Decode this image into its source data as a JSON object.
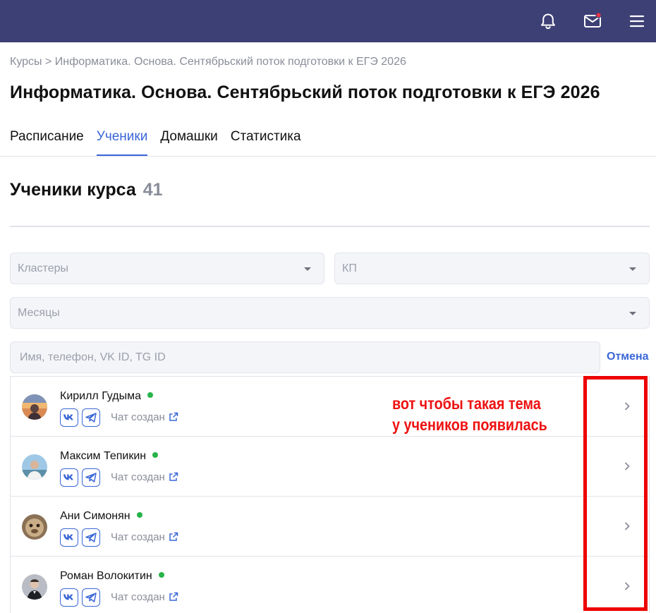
{
  "header": {
    "icons": [
      "bell-icon",
      "mail-icon",
      "menu-icon"
    ],
    "mail_badge_color": "#ee3344",
    "background": "#3d4075"
  },
  "breadcrumb": {
    "root": "Курсы",
    "separator": ">",
    "current": "Информатика. Основа. Сентябрьский поток подготовки к ЕГЭ 2026"
  },
  "page": {
    "title": "Информатика. Основа. Сентябрьский поток подготовки к ЕГЭ 2026"
  },
  "tabs": [
    {
      "label": "Расписание",
      "active": false
    },
    {
      "label": "Ученики",
      "active": true
    },
    {
      "label": "Домашки",
      "active": false
    },
    {
      "label": "Статистика",
      "active": false
    }
  ],
  "students_section": {
    "title": "Ученики курса",
    "count": "41"
  },
  "filters": {
    "clusters_placeholder": "Кластеры",
    "kp_placeholder": "КП",
    "months_placeholder": "Месяцы",
    "search_placeholder": "Имя, телефон, VK ID, TG ID",
    "cancel_label": "Отмена"
  },
  "students": [
    {
      "name": "Кирилл Гудыма",
      "online": true,
      "chat_label": "Чат создан",
      "vk_label": "vk"
    },
    {
      "name": "Максим Тепикин",
      "online": true,
      "chat_label": "Чат создан",
      "vk_label": "vk"
    },
    {
      "name": "Ани Симонян",
      "online": true,
      "chat_label": "Чат создан",
      "vk_label": "vk"
    },
    {
      "name": "Роман Волокитин",
      "online": true,
      "chat_label": "Чат создан",
      "vk_label": "vk"
    }
  ],
  "annotation": {
    "line1": "вот чтобы такая тема",
    "line2": "у учеников появилась",
    "color": "#ee1111"
  },
  "colors": {
    "accent": "#3a66d6",
    "online": "#27b34a",
    "muted": "#8a8d99"
  }
}
